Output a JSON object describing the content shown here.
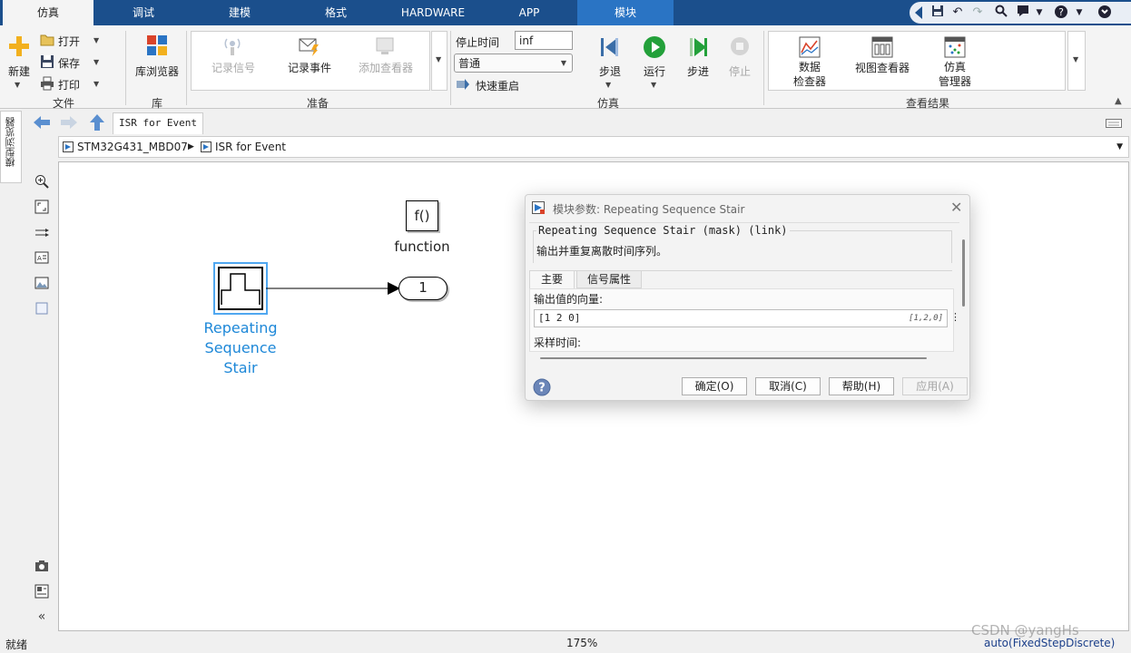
{
  "tabs": [
    {
      "label": "仿真",
      "active": true
    },
    {
      "label": "调试"
    },
    {
      "label": "建模"
    },
    {
      "label": "格式"
    },
    {
      "label": "HARDWARE"
    },
    {
      "label": "APP"
    },
    {
      "label": "模块"
    }
  ],
  "ribbon": {
    "file": {
      "new_label": "新建",
      "open_label": "打开",
      "save_label": "保存",
      "print_label": "打印",
      "group_label": "文件"
    },
    "library": {
      "browser_label": "库浏览器",
      "group_label": "库"
    },
    "prepare": {
      "log_signals": "记录信号",
      "log_events": "记录事件",
      "add_viewer": "添加查看器",
      "group_label": "准备"
    },
    "simulation": {
      "stop_time_label": "停止时间",
      "stop_time_value": "inf",
      "mode_value": "普通",
      "fast_restart": "快速重启",
      "step_back": "步退",
      "run": "运行",
      "step_forward": "步进",
      "stop": "停止",
      "group_label": "仿真"
    },
    "review": {
      "data_inspector_1": "数据",
      "data_inspector_2": "检查器",
      "viewer_manager": "视图查看器",
      "sim_manager_1": "仿真",
      "sim_manager_2": "管理器",
      "group_label": "查看结果"
    }
  },
  "left_panel": {
    "model_browser": "模型浏览器"
  },
  "editor": {
    "tab_label": "ISR for Event",
    "breadcrumb": [
      "STM32G431_MBD07",
      "ISR for Event"
    ]
  },
  "canvas": {
    "function_block_text": "f()",
    "function_block_label": "function",
    "stair_label_lines": [
      "Repeating",
      "Sequence",
      "Stair"
    ],
    "outport_value": "1"
  },
  "dialog": {
    "title": "模块参数: Repeating Sequence Stair",
    "section_title": "Repeating Sequence Stair (mask) (link)",
    "description": "输出并重复离散时间序列。",
    "tabs": [
      "主要",
      "信号属性"
    ],
    "vector_label": "输出值的向量:",
    "vector_value": "[1 2 0]",
    "vector_hint": "[1,2,0]",
    "sample_time_label": "采样时间:",
    "ok": "确定(O)",
    "cancel": "取消(C)",
    "help": "帮助(H)",
    "apply": "应用(A)"
  },
  "status": {
    "left": "就绪",
    "zoom": "175%",
    "solver": "auto(FixedStepDiscrete)",
    "watermark": "CSDN @yangHs"
  },
  "colors": {
    "tabbar": "#1b4f8c",
    "accent": "#2a74c4",
    "block_label": "#1e88d8",
    "run_green": "#23a03a"
  }
}
